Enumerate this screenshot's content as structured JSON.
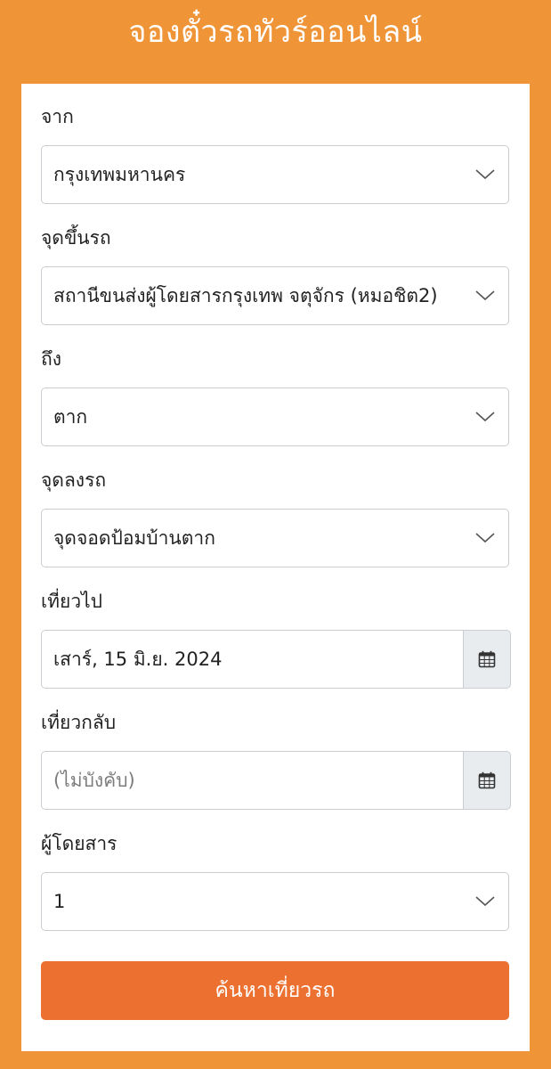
{
  "header": {
    "title": "จองตั๋วรถทัวร์ออนไลน์"
  },
  "form": {
    "origin": {
      "label": "จาก",
      "value": "กรุงเทพมหานคร"
    },
    "boarding_point": {
      "label": "จุดขึ้นรถ",
      "value": "สถานีขนส่งผู้โดยสารกรุงเทพ จตุจักร (หมอชิต2)"
    },
    "destination": {
      "label": "ถึง",
      "value": "ตาก"
    },
    "drop_point": {
      "label": "จุดลงรถ",
      "value": "จุดจอดป้อมบ้านตาก"
    },
    "departure_date": {
      "label": "เที่ยวไป",
      "value": "เสาร์, 15 มิ.ย. 2024"
    },
    "return_date": {
      "label": "เที่ยวกลับ",
      "placeholder": "(ไม่บังคับ)"
    },
    "passengers": {
      "label": "ผู้โดยสาร",
      "value": "1"
    },
    "search_button_label": "ค้นหาเที่ยวรถ"
  },
  "icons": {
    "dropdown": "chevron-down-icon",
    "date_picker": "calendar-icon"
  },
  "colors": {
    "page_background": "#ef9437",
    "button_background": "#ec7030",
    "addon_background": "#e9ecef"
  }
}
